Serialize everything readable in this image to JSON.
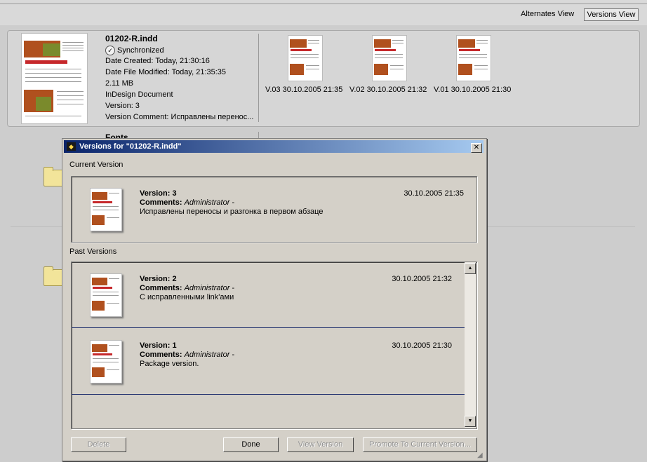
{
  "toolbar": {
    "alternates_view": "Alternates View",
    "versions_view": "Versions View"
  },
  "asset": {
    "file_name": "01202-R.indd",
    "status": "Synchronized",
    "date_created": "Date Created: Today, 21:30:16",
    "date_modified": "Date File Modified: Today, 21:35:35",
    "size": "2.11 MB",
    "type": "InDesign Document",
    "version": "Version: 3",
    "version_comment": "Version Comment: Исправлены перенос...",
    "versions": [
      {
        "label": "V.03 30.10.2005 21:35"
      },
      {
        "label": "V.02 30.10.2005 21:32"
      },
      {
        "label": "V.01 30.10.2005 21:30"
      }
    ]
  },
  "fonts_label": "Fonts",
  "dialog": {
    "title": "Versions for \"01202-R.indd\"",
    "current_label": "Current Version",
    "past_label": "Past Versions",
    "current": {
      "name": "Version: 3",
      "comments_label": "Comments:",
      "author": "Administrator",
      "dash": "-",
      "text": "Исправлены переносы и разгонка в первом абзаце",
      "date": "30.10.2005 21:35"
    },
    "past": [
      {
        "name": "Version: 2",
        "comments_label": "Comments:",
        "author": "Administrator",
        "dash": "-",
        "text": "С исправленными link'ами",
        "date": "30.10.2005 21:32"
      },
      {
        "name": "Version: 1",
        "comments_label": "Comments:",
        "author": "Administrator",
        "dash": "-",
        "text": "Package version.",
        "date": "30.10.2005 21:30"
      }
    ],
    "buttons": {
      "delete": "Delete",
      "done": "Done",
      "view_version": "View Version",
      "promote": "Promote To Current Version..."
    }
  },
  "colors": {
    "title_bar_start": "#0a246a",
    "title_bar_end": "#a6caf0",
    "dialog_bg": "#d4d0c8",
    "separator": "#1a2a6a"
  }
}
